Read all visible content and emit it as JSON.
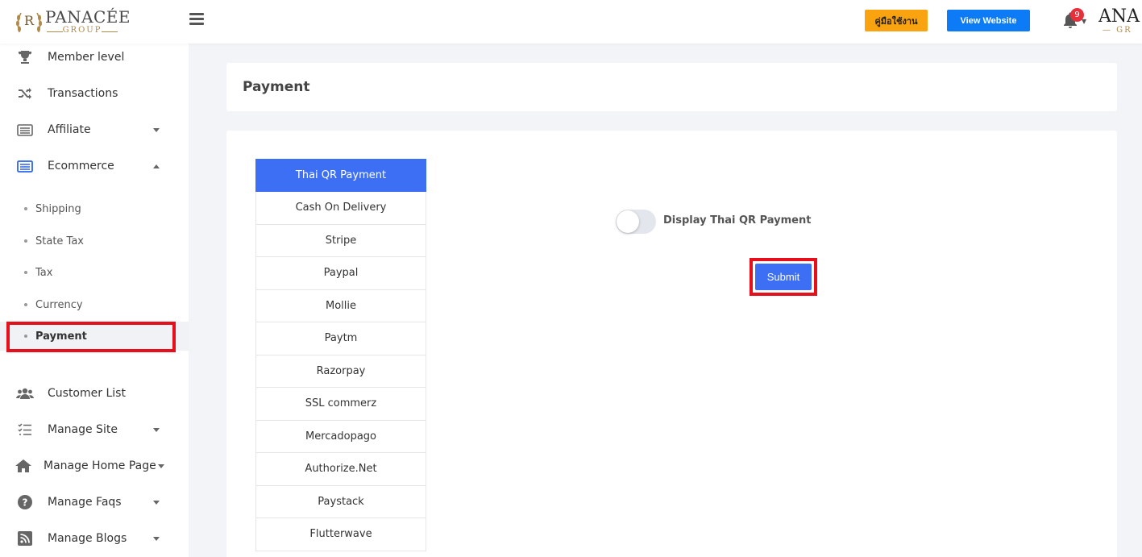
{
  "header": {
    "logo_text": "PANACÉE",
    "logo_sub": "GROUP",
    "manual_button": "คู่มือใช้งาน",
    "view_website_button": "View Website",
    "notification_count": "9",
    "brand_right": "ANA",
    "brand_right_sub": "— GR",
    "colors": {
      "manual": "#f8a30f",
      "view": "#0d7bf5",
      "badge": "#e8303d"
    }
  },
  "sidebar": {
    "items": [
      {
        "label": "Member level",
        "icon": "trophy-icon"
      },
      {
        "label": "Transactions",
        "icon": "shuffle-icon"
      },
      {
        "label": "Affiliate",
        "icon": "list-card-icon",
        "caret": "down"
      },
      {
        "label": "Ecommerce",
        "icon": "ecommerce-list-icon",
        "caret": "up",
        "expanded": true
      }
    ],
    "sub_items": [
      {
        "label": "Shipping"
      },
      {
        "label": "State Tax"
      },
      {
        "label": "Tax"
      },
      {
        "label": "Currency"
      },
      {
        "label": "Payment",
        "active": true
      }
    ],
    "items_bottom": [
      {
        "label": "Customer List",
        "icon": "users-icon"
      },
      {
        "label": "Manage Site",
        "icon": "checklist-icon",
        "caret": "down"
      },
      {
        "label": "Manage Home Page",
        "icon": "home-icon",
        "caret": "down"
      },
      {
        "label": "Manage Faqs",
        "icon": "question-icon",
        "caret": "down"
      },
      {
        "label": "Manage Blogs",
        "icon": "rss-icon",
        "caret": "down"
      }
    ]
  },
  "main": {
    "page_title": "Payment",
    "payment_tabs": [
      "Thai QR Payment",
      "Cash On Delivery",
      "Stripe",
      "Paypal",
      "Mollie",
      "Paytm",
      "Razorpay",
      "SSL commerz",
      "Mercadopago",
      "Authorize.Net",
      "Paystack",
      "Flutterwave"
    ],
    "active_tab": "Thai QR Payment",
    "toggle_label": "Display Thai QR Payment",
    "toggle_on": false,
    "submit_label": "Submit",
    "accent_color": "#3d6ff5"
  }
}
